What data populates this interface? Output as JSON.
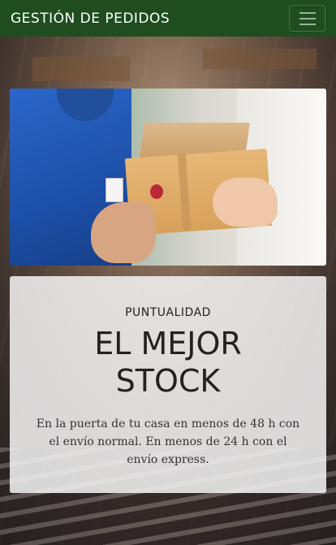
{
  "navbar": {
    "brand": "GESTIÓN DE PEDIDOS",
    "toggler_icon": "hamburger-menu-icon",
    "background_color": "#1f4d1f"
  },
  "hero_image": {
    "subject": "delivery-person-handing-boxes"
  },
  "card": {
    "subtitle": "PUNTUALIDAD",
    "title_line1": "EL MEJOR",
    "title_line2": "STOCK",
    "description": "En la puerta de tu casa en menos de 48 h con el envío normal. En menos de 24 h con el envío express."
  }
}
